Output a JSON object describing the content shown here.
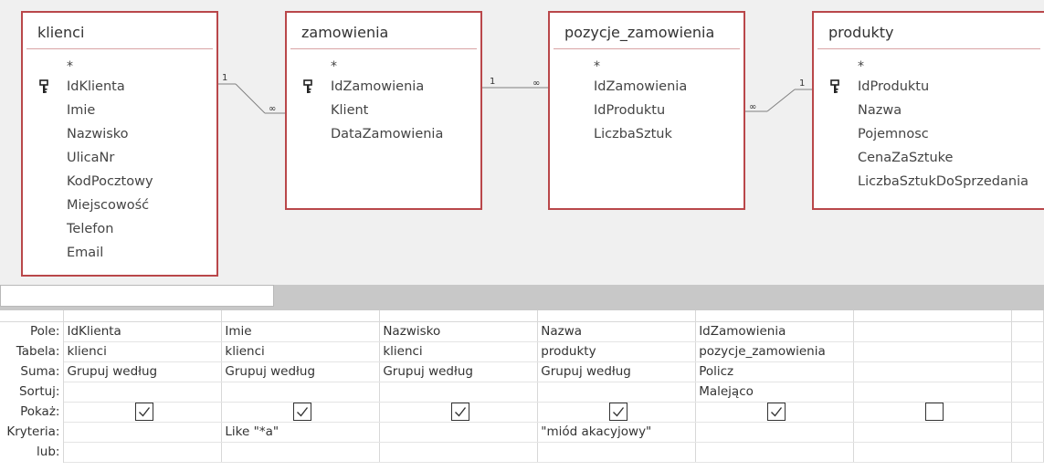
{
  "tables": [
    {
      "name": "klienci",
      "star": "*",
      "fields": [
        "IdKlienta",
        "Imie",
        "Nazwisko",
        "UlicaNr",
        "KodPocztowy",
        "Miejscowość",
        "Telefon",
        "Email"
      ],
      "key_index": 0
    },
    {
      "name": "zamowienia",
      "star": "*",
      "fields": [
        "IdZamowienia",
        "Klient",
        "DataZamowienia"
      ],
      "key_index": 0
    },
    {
      "name": "pozycje_zamowienia",
      "star": "*",
      "fields": [
        "IdZamowienia",
        "IdProduktu",
        "LiczbaSztuk"
      ],
      "key_index": -1
    },
    {
      "name": "produkty",
      "star": "*",
      "fields": [
        "IdProduktu",
        "Nazwa",
        "Pojemnosc",
        "CenaZaSztuke",
        "LiczbaSztukDoSprzedania"
      ],
      "key_index": 0
    }
  ],
  "relations": [
    {
      "one": "1",
      "many": "∞"
    },
    {
      "one": "1",
      "many": "∞"
    },
    {
      "one": "1",
      "many": "∞"
    }
  ],
  "grid": {
    "row_labels": {
      "field": "Pole:",
      "table": "Tabela:",
      "total": "Suma:",
      "sort": "Sortuj:",
      "show": "Pokaż:",
      "criteria": "Kryteria:",
      "or": "lub:"
    },
    "columns": [
      {
        "field": "IdKlienta",
        "table": "klienci",
        "total": "Grupuj według",
        "sort": "",
        "show": true,
        "criteria": ""
      },
      {
        "field": "Imie",
        "table": "klienci",
        "total": "Grupuj według",
        "sort": "",
        "show": true,
        "criteria": "Like \"*a\""
      },
      {
        "field": "Nazwisko",
        "table": "klienci",
        "total": "Grupuj według",
        "sort": "",
        "show": true,
        "criteria": ""
      },
      {
        "field": "Nazwa",
        "table": "produkty",
        "total": "Grupuj według",
        "sort": "",
        "show": true,
        "criteria": "\"miód akacyjowy\""
      },
      {
        "field": "IdZamowienia",
        "table": "pozycje_zamowienia",
        "total": "Policz",
        "sort": "Malejąco",
        "show": true,
        "criteria": ""
      },
      {
        "field": "",
        "table": "",
        "total": "",
        "sort": "",
        "show": false,
        "criteria": ""
      }
    ]
  },
  "colors": {
    "table_border": "#b9474a",
    "line": "#808080"
  }
}
